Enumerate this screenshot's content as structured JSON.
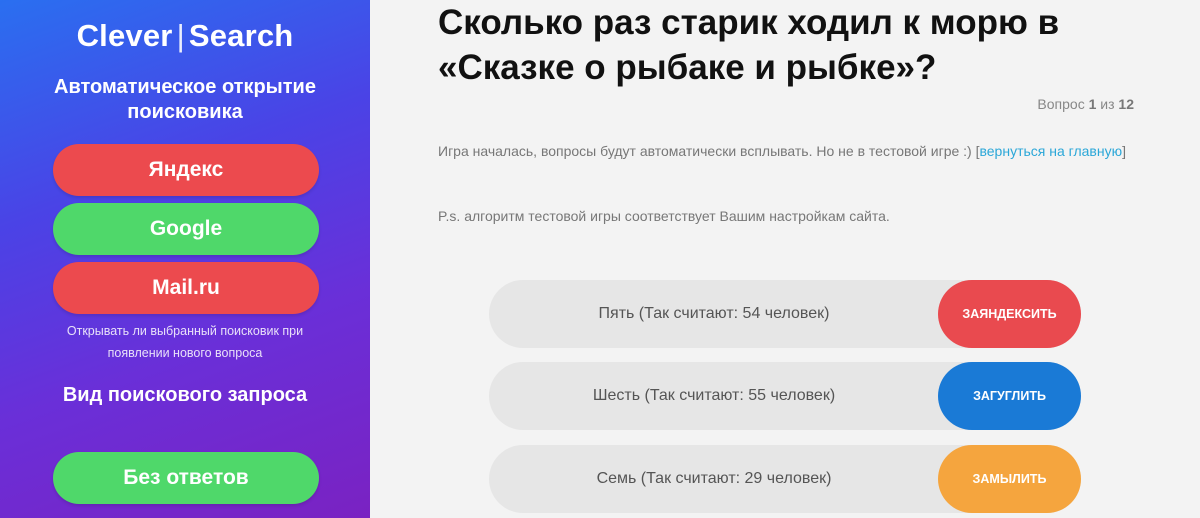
{
  "sidebar": {
    "logo_left": "Clever",
    "logo_sep": "|",
    "logo_right": "Search",
    "heading_engine": "Автоматическое открытие поисковика",
    "engines": [
      {
        "label": "Яндекс",
        "color": "#ec4a4e"
      },
      {
        "label": "Google",
        "color": "#4fd86a"
      },
      {
        "label": "Mail.ru",
        "color": "#ec4a4e"
      }
    ],
    "note": "Открывать ли выбранный поисковик при появлении нового вопроса",
    "heading_query": "Вид поискового запроса",
    "query_mode_label": "Без ответов"
  },
  "main": {
    "question": "Сколько раз старик ходил к морю в «Сказке о рыбаке и рыбке»?",
    "counter": {
      "prefix": "Вопрос",
      "current": "1",
      "sep": "из",
      "total": "12"
    },
    "info_text": "Игра началась, вопросы будут автоматически всплывать. Но не в тестовой игре :) [",
    "info_link": "вернуться на главную",
    "info_close": "]",
    "ps": "P.s. алгоритм тестовой игры соответствует Вашим настройкам сайта.",
    "answers": [
      {
        "text": "Пять (Так считают: 54 человек)",
        "button": "ЗАЯНДЕКСИТЬ",
        "button_color": "#e94a4f"
      },
      {
        "text": "Шесть (Так считают: 55 человек)",
        "button": "ЗАГУГЛИТЬ",
        "button_color": "#1a7ad6"
      },
      {
        "text": "Семь (Так считают: 29 человек)",
        "button": "ЗАМЫЛИТЬ",
        "button_color": "#f5a53e"
      }
    ]
  },
  "colors": {
    "accent_link": "#2ba7d8",
    "sidebar_gradient_start": "#2a6ff0",
    "sidebar_gradient_end": "#7a22c2"
  }
}
